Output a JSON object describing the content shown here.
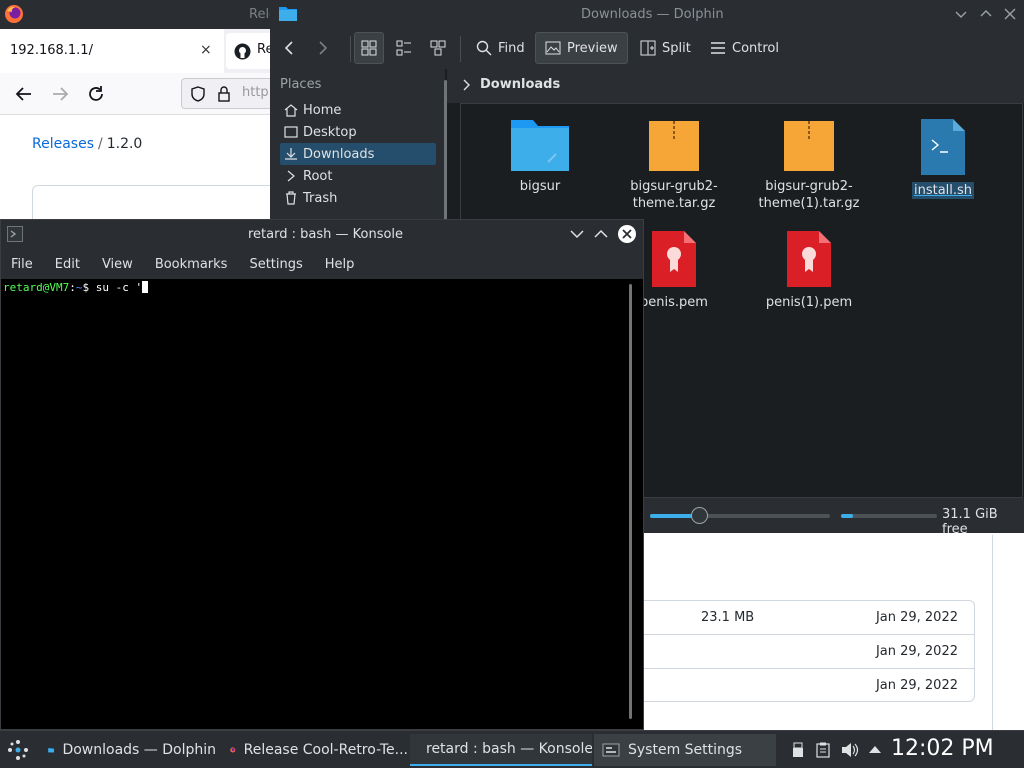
{
  "firefox": {
    "title": "Rele",
    "tab1": {
      "label": "192.168.1.1/",
      "close": "×"
    },
    "tab2": {
      "label": "Re"
    },
    "url": "http",
    "breadcrumb": {
      "link": "Releases",
      "sep": "/",
      "version": "1.2.0"
    },
    "assets": [
      {
        "size": "23.1 MB",
        "date": "Jan 29, 2022"
      },
      {
        "size": "",
        "date": "Jan 29, 2022"
      },
      {
        "size": "",
        "date": "Jan 29, 2022"
      }
    ]
  },
  "dolphin": {
    "title": "Downloads — Dolphin",
    "toolbar": {
      "find": "Find",
      "preview": "Preview",
      "split": "Split",
      "control": "Control"
    },
    "places": {
      "heading": "Places",
      "items": [
        "Home",
        "Desktop",
        "Downloads",
        "Root",
        "Trash"
      ]
    },
    "breadcrumb": "Downloads",
    "files": [
      {
        "name": "bigsur",
        "icon": "folder-icon"
      },
      {
        "name": "bigsur-grub2-theme.tar.gz",
        "line1": "bigsur-grub2-",
        "line2": "theme.tar.gz",
        "icon": "archive-icon"
      },
      {
        "name": "bigsur-grub2-theme(1).tar.gz",
        "line1": "bigsur-grub2-",
        "line2": "theme(1).tar.gz",
        "icon": "archive-icon"
      },
      {
        "name": "install.sh",
        "icon": "shell-script-icon"
      },
      {
        "name": "penis.pem",
        "icon": "certificate-icon"
      },
      {
        "name": "penis(1).pem",
        "icon": "certificate-icon"
      }
    ],
    "free_space": "31.1 GiB free"
  },
  "konsole": {
    "title": "retard : bash — Konsole",
    "menu": [
      "File",
      "Edit",
      "View",
      "Bookmarks",
      "Settings",
      "Help"
    ],
    "prompt": {
      "user": "retard@VM7",
      "sep": ":",
      "dir": "~",
      "symbol": "$",
      "command": "su -c '"
    }
  },
  "taskbar": {
    "tasks": [
      "Downloads — Dolphin",
      "Release Cool-Retro-Te...",
      "retard : bash — Konsole",
      "System Settings"
    ],
    "clock": "12:02 PM"
  },
  "colors": {
    "accent": "#3daee9",
    "selection": "#254e6c",
    "panel": "#2a2e32",
    "view_bg": "#1b1e20"
  }
}
